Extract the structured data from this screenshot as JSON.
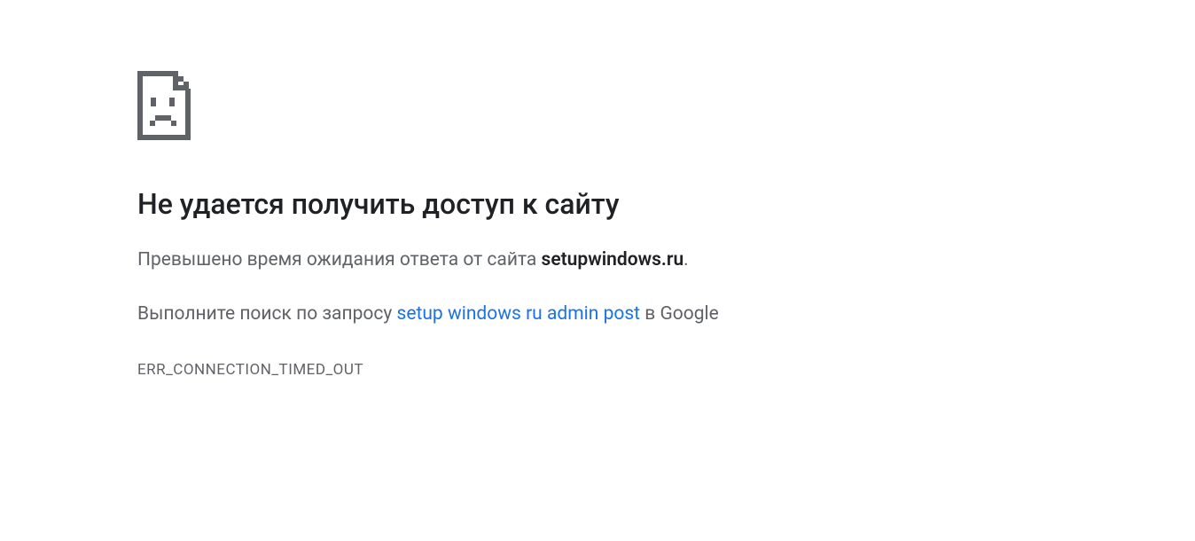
{
  "error": {
    "title": "Не удается получить доступ к сайту",
    "description_prefix": "Превышено время ожидания ответа от сайта ",
    "domain": "setupwindows.ru",
    "description_suffix": ".",
    "search_prefix": "Выполните поиск по запросу ",
    "search_query": "setup windows ru admin post",
    "search_suffix": " в Google",
    "error_code": "ERR_CONNECTION_TIMED_OUT"
  }
}
